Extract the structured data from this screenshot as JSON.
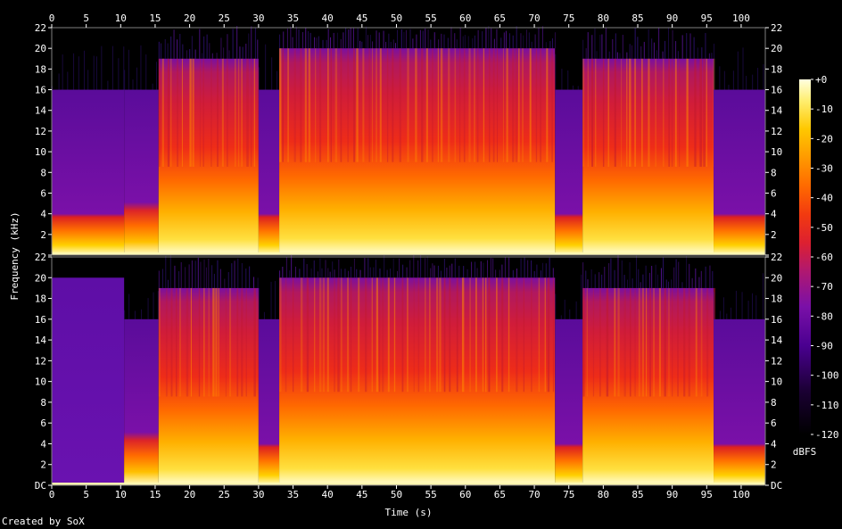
{
  "chart_data": {
    "type": "heatmap",
    "title": "",
    "xlabel": "Time (s)",
    "ylabel": "Frequency (kHz)",
    "x_ticks": [
      "0",
      "5",
      "10",
      "15",
      "20",
      "25",
      "30",
      "35",
      "40",
      "45",
      "50",
      "55",
      "60",
      "65",
      "70",
      "75",
      "80",
      "85",
      "90",
      "95",
      "100"
    ],
    "y_ticks": [
      "DC",
      "2",
      "4",
      "6",
      "8",
      "10",
      "12",
      "14",
      "16",
      "18",
      "20",
      "22"
    ],
    "xlim": [
      0,
      103.5
    ],
    "ylim_khz": [
      0,
      22
    ],
    "colorbar": {
      "label": "dBFS",
      "ticks": [
        "+0",
        "-10",
        "-20",
        "-30",
        "-40",
        "-50",
        "-60",
        "-70",
        "-80",
        "-90",
        "-100",
        "-110",
        "-120"
      ],
      "range": [
        -120,
        0
      ],
      "colors": [
        "#000000",
        "#1a0032",
        "#3d0078",
        "#6a0eaa",
        "#9a1a98",
        "#c81c55",
        "#e8261c",
        "#ff5200",
        "#ff8c00",
        "#ffc000",
        "#ffe860",
        "#ffffd0"
      ]
    },
    "channels": [
      {
        "name": "top",
        "segments": [
          {
            "t": [
              0,
              10.5
            ],
            "cutoff_khz": 16,
            "level": "low"
          },
          {
            "t": [
              10.5,
              15.5
            ],
            "cutoff_khz": 16,
            "level": "low-mid"
          },
          {
            "t": [
              15.5,
              30
            ],
            "cutoff_khz": 19,
            "level": "high"
          },
          {
            "t": [
              30,
              33
            ],
            "cutoff_khz": 16,
            "level": "low"
          },
          {
            "t": [
              33,
              73
            ],
            "cutoff_khz": 20,
            "level": "high"
          },
          {
            "t": [
              73,
              77
            ],
            "cutoff_khz": 16,
            "level": "low"
          },
          {
            "t": [
              77,
              96
            ],
            "cutoff_khz": 19,
            "level": "high"
          },
          {
            "t": [
              96,
              103.5
            ],
            "cutoff_khz": 16,
            "level": "low"
          }
        ]
      },
      {
        "name": "bottom",
        "segments": [
          {
            "t": [
              0,
              10.5
            ],
            "cutoff_khz": 20,
            "level": "flat"
          },
          {
            "t": [
              10.5,
              15.5
            ],
            "cutoff_khz": 16,
            "level": "low-mid"
          },
          {
            "t": [
              15.5,
              30
            ],
            "cutoff_khz": 19,
            "level": "high"
          },
          {
            "t": [
              30,
              33
            ],
            "cutoff_khz": 16,
            "level": "low"
          },
          {
            "t": [
              33,
              73
            ],
            "cutoff_khz": 20,
            "level": "high"
          },
          {
            "t": [
              73,
              77
            ],
            "cutoff_khz": 16,
            "level": "low"
          },
          {
            "t": [
              77,
              96
            ],
            "cutoff_khz": 19,
            "level": "high"
          },
          {
            "t": [
              96,
              103.5
            ],
            "cutoff_khz": 16,
            "level": "low"
          }
        ]
      }
    ]
  },
  "footer": {
    "credit": "Created by SoX"
  }
}
